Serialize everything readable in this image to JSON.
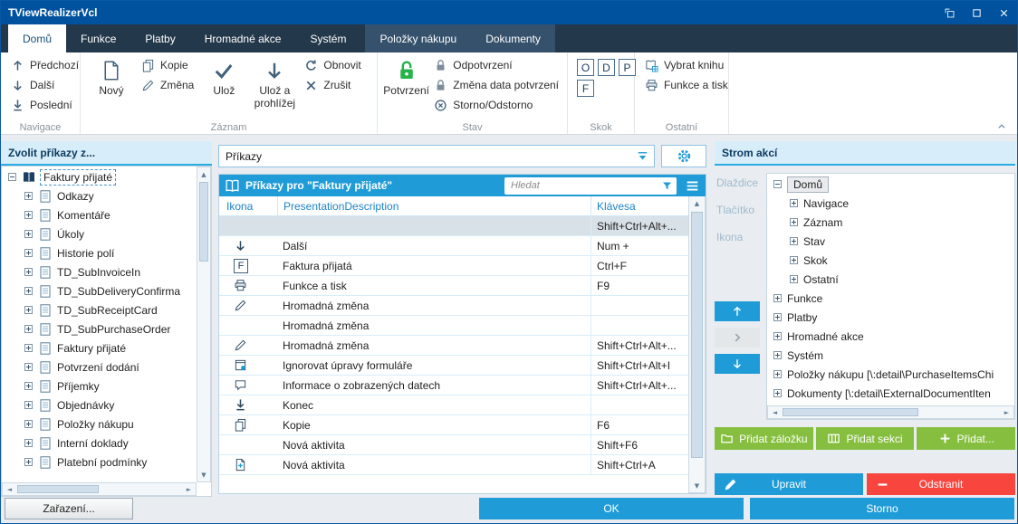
{
  "window": {
    "title": "TViewRealizerVcl"
  },
  "tabs": {
    "items": [
      {
        "label": "Domů",
        "state": "active"
      },
      {
        "label": "Funkce",
        "state": "normal"
      },
      {
        "label": "Platby",
        "state": "normal"
      },
      {
        "label": "Hromadné akce",
        "state": "normal"
      },
      {
        "label": "Systém",
        "state": "normal"
      },
      {
        "label": "Položky nákupu",
        "state": "context"
      },
      {
        "label": "Dokumenty",
        "state": "context"
      }
    ]
  },
  "ribbon": {
    "groups": {
      "navigace": {
        "label": "Navigace",
        "predchozi": "Předchozí",
        "dalsi": "Další",
        "posledni": "Poslední"
      },
      "zaznam": {
        "label": "Záznam",
        "novy": "Nový",
        "kopie": "Kopie",
        "zmena": "Změna",
        "uloz": "Ulož",
        "uloz_a_prohlizej": "Ulož a prohlížej",
        "obnovit": "Obnovit",
        "zrusit": "Zrušit"
      },
      "stav": {
        "label": "Stav",
        "potvrzeni": "Potvrzení",
        "odpotvrzeni": "Odpotvrzení",
        "zmena_data": "Změna data potvrzení",
        "storno_odstorno": "Storno/Odstorno"
      },
      "skok": {
        "label": "Skok",
        "keys": [
          "O",
          "D",
          "P",
          "F"
        ]
      },
      "ostatni": {
        "label": "Ostatní",
        "vybrat_knihu": "Vybrat knihu",
        "funkce_a_tisk": "Funkce a tisk"
      }
    }
  },
  "left_panel": {
    "header": "Zvolit příkazy z...",
    "tree": [
      {
        "label": "Faktury přijaté",
        "icon": "open-book",
        "expanded": true,
        "selected": true
      },
      {
        "label": "Odkazy",
        "icon": "document"
      },
      {
        "label": "Komentáře",
        "icon": "document"
      },
      {
        "label": "Úkoly",
        "icon": "document"
      },
      {
        "label": "Historie polí",
        "icon": "document"
      },
      {
        "label": "TD_SubInvoiceIn",
        "icon": "document"
      },
      {
        "label": "TD_SubDeliveryConfirma",
        "icon": "document"
      },
      {
        "label": "TD_SubReceiptCard",
        "icon": "document"
      },
      {
        "label": "TD_SubPurchaseOrder",
        "icon": "document"
      },
      {
        "label": "Faktury přijaté",
        "icon": "document"
      },
      {
        "label": "Potvrzení dodání",
        "icon": "document"
      },
      {
        "label": "Příjemky",
        "icon": "document"
      },
      {
        "label": "Objednávky",
        "icon": "document"
      },
      {
        "label": "Položky nákupu",
        "icon": "document"
      },
      {
        "label": "Interní doklady",
        "icon": "document"
      },
      {
        "label": "Platební podmínky",
        "icon": "document"
      }
    ]
  },
  "center": {
    "combo_value": "Příkazy",
    "grid": {
      "title": "Příkazy pro \"Faktury přijaté\"",
      "search_placeholder": "Hledat",
      "columns": {
        "icon": "Ikona",
        "description": "PresentationDescription",
        "key": "Klávesa"
      },
      "rows": [
        {
          "icon": "",
          "description": "",
          "key": "Shift+Ctrl+Alt+...",
          "selected": true
        },
        {
          "icon": "arrow-down",
          "description": "Další",
          "key": "Num +"
        },
        {
          "icon": "key-f",
          "icon_letter": "F",
          "description": "Faktura přijatá",
          "key": "Ctrl+F"
        },
        {
          "icon": "printer",
          "description": "Funkce a tisk",
          "key": "F9"
        },
        {
          "icon": "pencil",
          "description": "Hromadná změna",
          "key": ""
        },
        {
          "icon": "",
          "description": "Hromadná změna",
          "key": ""
        },
        {
          "icon": "pencil",
          "description": "Hromadná změna",
          "key": "Shift+Ctrl+Alt+..."
        },
        {
          "icon": "form",
          "description": "Ignorovat úpravy formuláře",
          "key": "Shift+Ctrl+Alt+I"
        },
        {
          "icon": "chat-bubble",
          "description": "Informace o zobrazených datech",
          "key": "Shift+Ctrl+Alt+..."
        },
        {
          "icon": "arrow-down-end",
          "description": "Konec",
          "key": ""
        },
        {
          "icon": "copy",
          "description": "Kopie",
          "key": "F6"
        },
        {
          "icon": "",
          "description": "Nová aktivita",
          "key": "Shift+F6"
        },
        {
          "icon": "document-new",
          "description": "Nová aktivita",
          "key": "Shift+Ctrl+A"
        }
      ]
    }
  },
  "right_panel": {
    "header": "Strom akcí",
    "side_options": [
      "Dlaždice",
      "Tlačítko",
      "Ikona"
    ],
    "tree": [
      {
        "label": "Domů",
        "level": 0,
        "expanded": true,
        "selected": true
      },
      {
        "label": "Navigace",
        "level": 1
      },
      {
        "label": "Záznam",
        "level": 1
      },
      {
        "label": "Stav",
        "level": 1
      },
      {
        "label": "Skok",
        "level": 1
      },
      {
        "label": "Ostatní",
        "level": 1
      },
      {
        "label": "Funkce",
        "level": 0
      },
      {
        "label": "Platby",
        "level": 0
      },
      {
        "label": "Hromadné akce",
        "level": 0
      },
      {
        "label": "Systém",
        "level": 0
      },
      {
        "label": "Položky nákupu [\\:detail\\PurchaseItemsChi",
        "level": 0
      },
      {
        "label": "Dokumenty [\\:detail\\ExternalDocumentIten",
        "level": 0
      }
    ],
    "buttons": {
      "add_bookmark": "Přidat záložku",
      "add_section": "Přidat sekci",
      "add": "Přidat...",
      "edit": "Upravit",
      "remove": "Odstranit"
    }
  },
  "footer": {
    "zarazeni": "Zařazení...",
    "ok": "OK",
    "storno": "Storno"
  },
  "colors": {
    "titlebar": "#00529e",
    "tabstrip": "#24384b",
    "accent_blue": "#1f9cd8",
    "panel_header_bg": "#d7edf9",
    "panel_header_underline": "#2aabe2",
    "green_button": "#86bf3f",
    "red_button": "#f8463f",
    "confirm_green": "#27b24a"
  }
}
